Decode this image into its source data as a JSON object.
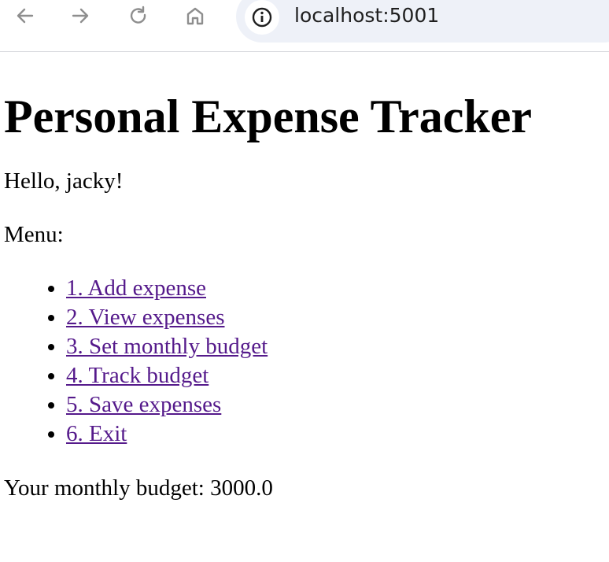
{
  "browser": {
    "url": "localhost:5001",
    "icons": [
      "back-arrow-icon",
      "forward-arrow-icon",
      "reload-icon",
      "home-icon",
      "site-info-icon"
    ]
  },
  "page": {
    "title": "Personal Expense Tracker",
    "greeting": "Hello, jacky!",
    "menu_label": "Menu:",
    "menu_items": [
      {
        "label": "1. Add expense"
      },
      {
        "label": "2. View expenses"
      },
      {
        "label": "3. Set monthly budget"
      },
      {
        "label": "4. Track budget"
      },
      {
        "label": "5. Save expenses"
      },
      {
        "label": "6. Exit"
      }
    ],
    "budget_text": "Your monthly budget: 3000.0"
  },
  "colors": {
    "visited_link": "#551a8b",
    "omnibox_bg": "#eef1f8",
    "icon_gray": "#8e8e8e"
  }
}
